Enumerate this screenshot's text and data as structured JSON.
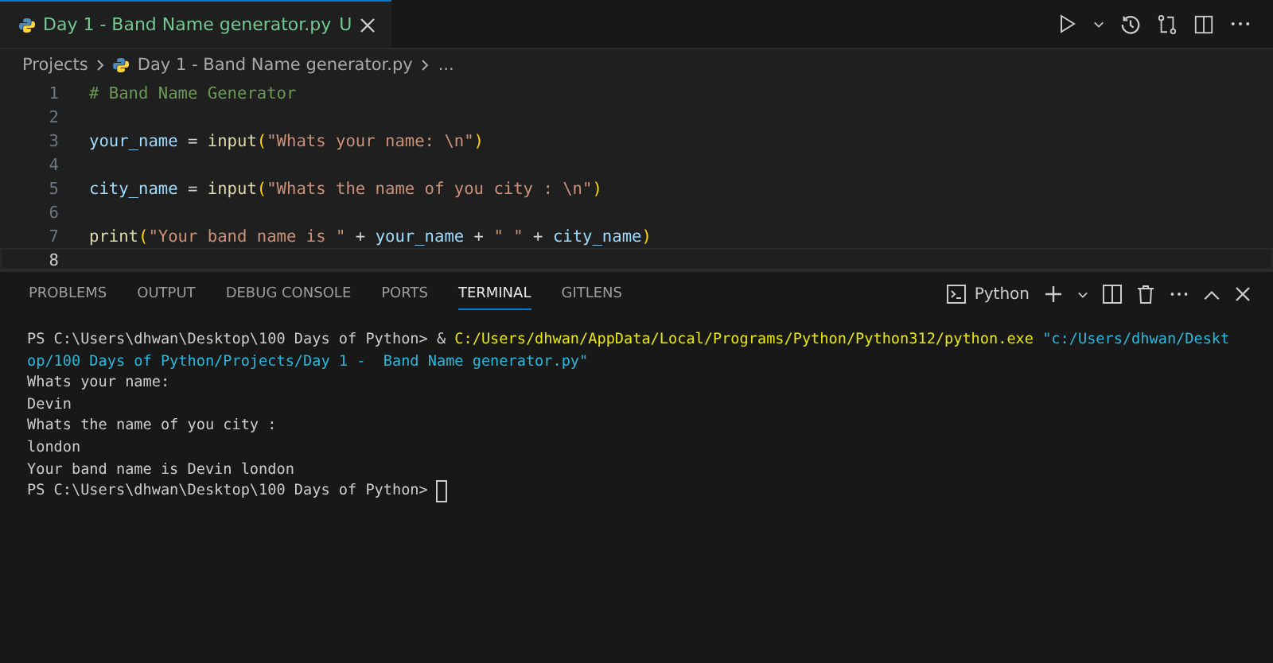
{
  "editor_tab": {
    "label": "Day 1 -  Band Name generator.py",
    "badge": "U",
    "selected": true
  },
  "breadcrumbs": {
    "folder": "Projects",
    "file": "Day 1 -  Band Name generator.py",
    "more": "..."
  },
  "code_lines": [
    {
      "number": "1",
      "current": false,
      "tokens": [
        {
          "kind": "comment",
          "text": "# Band Name Generator"
        }
      ]
    },
    {
      "number": "2",
      "current": false
    },
    {
      "number": "3",
      "current": false,
      "tokens": [
        {
          "kind": "var",
          "text": "your_name"
        },
        {
          "kind": "op",
          "text": " = "
        },
        {
          "kind": "func",
          "text": "input"
        },
        {
          "kind": "paren",
          "text": "("
        },
        {
          "kind": "string",
          "text": "\"Whats your name: \\n\""
        },
        {
          "kind": "paren",
          "text": ")"
        }
      ]
    },
    {
      "number": "4",
      "current": false
    },
    {
      "number": "5",
      "current": false,
      "tokens": [
        {
          "kind": "var",
          "text": "city_name"
        },
        {
          "kind": "op",
          "text": " = "
        },
        {
          "kind": "func",
          "text": "input"
        },
        {
          "kind": "paren",
          "text": "("
        },
        {
          "kind": "string",
          "text": "\"Whats the name of you city : \\n\""
        },
        {
          "kind": "paren",
          "text": ")"
        }
      ]
    },
    {
      "number": "6",
      "current": false
    },
    {
      "number": "7",
      "current": false,
      "tokens": [
        {
          "kind": "func",
          "text": "print"
        },
        {
          "kind": "paren",
          "text": "("
        },
        {
          "kind": "string",
          "text": "\"Your band name is \""
        },
        {
          "kind": "op",
          "text": " + "
        },
        {
          "kind": "var",
          "text": "your_name"
        },
        {
          "kind": "op",
          "text": " + "
        },
        {
          "kind": "string",
          "text": "\" \""
        },
        {
          "kind": "op",
          "text": " + "
        },
        {
          "kind": "var",
          "text": "city_name"
        },
        {
          "kind": "paren",
          "text": ")"
        }
      ]
    },
    {
      "number": "8",
      "current": true
    }
  ],
  "panel_tabs": [
    {
      "label": "PROBLEMS",
      "selected": false
    },
    {
      "label": "OUTPUT",
      "selected": false
    },
    {
      "label": "DEBUG CONSOLE",
      "selected": false
    },
    {
      "label": "PORTS",
      "selected": false
    },
    {
      "label": "TERMINAL",
      "selected": true
    },
    {
      "label": "GITLENS",
      "selected": false
    }
  ],
  "terminal_name": "Python",
  "terminal_lines": [
    [
      {
        "kind": "plain",
        "text": "PS C:\\Users\\dhwan\\Desktop\\100 Days of Python> & "
      },
      {
        "kind": "path",
        "text": "C:/Users/dhwan/AppData/Local/Programs/Python/Python312/python.exe"
      },
      {
        "kind": "string",
        "text": "\"c:/Users/dhwan/Deskt"
      }
    ],
    [
      {
        "kind": "string",
        "text": "op/100 Days of Python/Projects/Day 1 -  Band Name generator.py\""
      }
    ],
    [
      {
        "kind": "plain",
        "text": "Whats your name:"
      }
    ],
    [
      {
        "kind": "plain",
        "text": "Devin"
      }
    ],
    [
      {
        "kind": "plain",
        "text": "Whats the name of you city :"
      }
    ],
    [
      {
        "kind": "plain",
        "text": "london"
      }
    ],
    [
      {
        "kind": "plain",
        "text": "Your band name is Devin london"
      }
    ],
    [
      {
        "kind": "plain",
        "text": "PS C:\\Users\\dhwan\\Desktop\\100 Days of Python> "
      }
    ]
  ]
}
